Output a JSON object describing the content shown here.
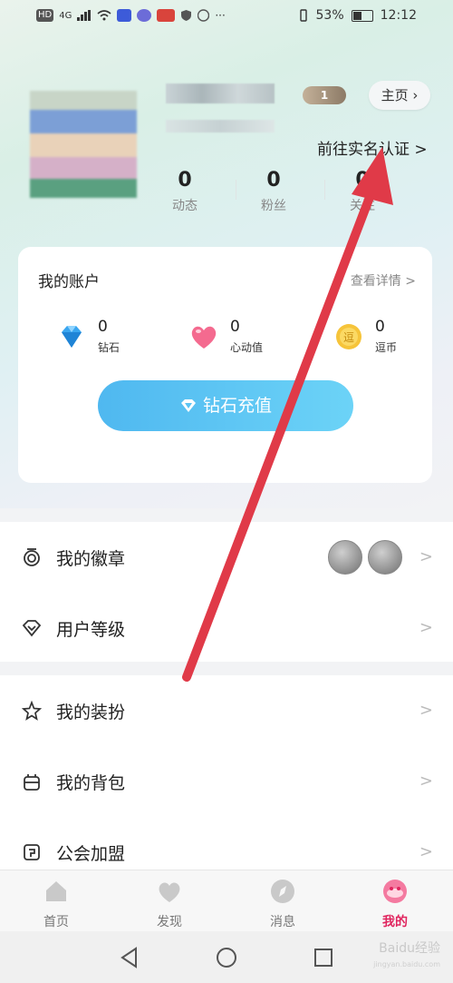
{
  "status_bar": {
    "left_chips": [
      "HD",
      "4G"
    ],
    "battery": "53%",
    "battery_level": 0.53,
    "time": "12:12"
  },
  "profile": {
    "level_badge": "1",
    "home_button": "主页 ›",
    "verify_link": "前往实名认证 >",
    "stats": [
      {
        "value": "0",
        "label": "动态"
      },
      {
        "value": "0",
        "label": "粉丝"
      },
      {
        "value": "0",
        "label": "关注"
      }
    ]
  },
  "account": {
    "title": "我的账户",
    "detail_link": "查看详情 >",
    "assets": [
      {
        "value": "0",
        "label": "钻石",
        "icon": "diamond-icon"
      },
      {
        "value": "0",
        "label": "心动值",
        "icon": "heart-icon"
      },
      {
        "value": "0",
        "label": "逗币",
        "icon": "coin-icon"
      }
    ],
    "recharge_button": "钻石充值"
  },
  "menu": {
    "group1": [
      {
        "label": "我的徽章",
        "icon": "badge-icon"
      },
      {
        "label": "用户等级",
        "icon": "diamond-outline-icon"
      }
    ],
    "group2": [
      {
        "label": "我的装扮",
        "icon": "star-sparkle-icon"
      },
      {
        "label": "我的背包",
        "icon": "backpack-icon"
      },
      {
        "label": "公会加盟",
        "icon": "guild-icon"
      }
    ],
    "chevron": ">"
  },
  "tabbar": {
    "tabs": [
      {
        "label": "首页",
        "icon": "home-icon"
      },
      {
        "label": "发现",
        "icon": "heart-icon"
      },
      {
        "label": "消息",
        "icon": "compass-icon"
      },
      {
        "label": "我的",
        "icon": "profile-icon",
        "active": true
      }
    ]
  },
  "watermark": {
    "text": "Baidu经验",
    "sub": "jingyan.baidu.com"
  },
  "colors": {
    "accent": "#e0245e",
    "recharge_start": "#4fb8f0",
    "recharge_end": "#6cd3f7",
    "arrow": "#e03a48"
  }
}
